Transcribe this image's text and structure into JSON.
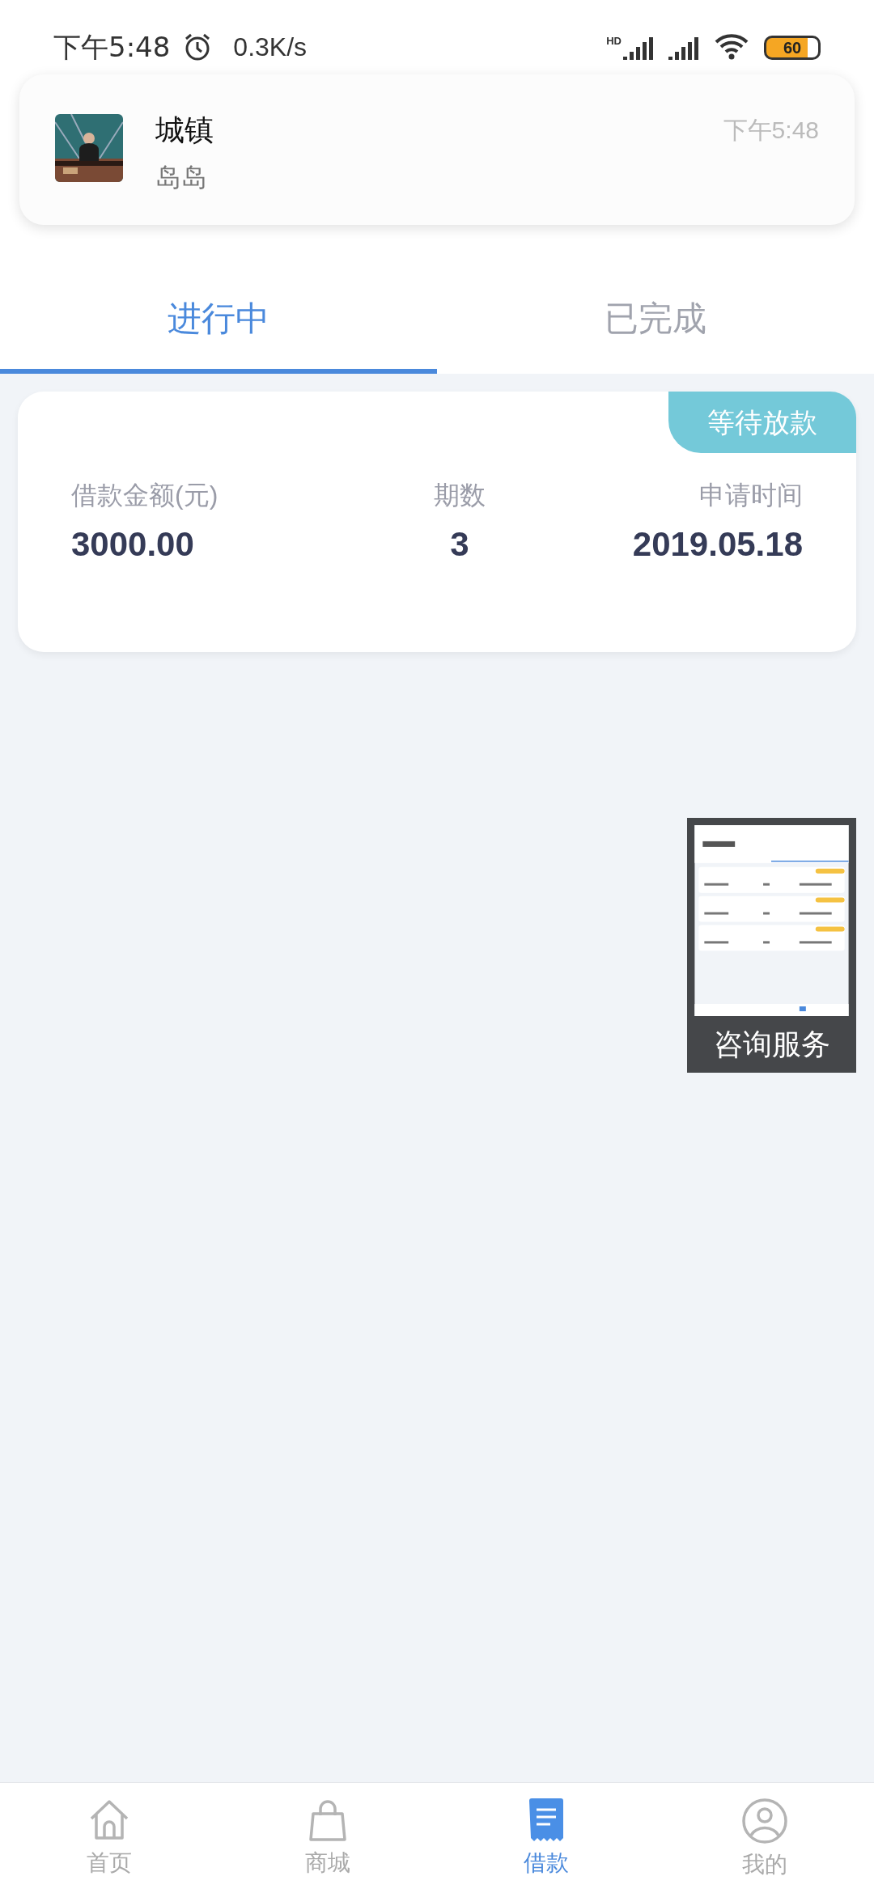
{
  "status_bar": {
    "time": "下午5:48",
    "speed": "0.3K/s",
    "network_label": "HD",
    "battery": "60"
  },
  "notification": {
    "title": "城镇",
    "body": "岛岛",
    "time": "下午5:48"
  },
  "tabs": [
    {
      "label": "进行中",
      "selected": true
    },
    {
      "label": "已完成",
      "selected": false
    }
  ],
  "loans": [
    {
      "status": "等待放款",
      "fields": [
        {
          "label": "借款金额(元)",
          "value": "3000.00"
        },
        {
          "label": "期数",
          "value": "3"
        },
        {
          "label": "申请时间",
          "value": "2019.05.18"
        }
      ]
    }
  ],
  "floating_button": {
    "label": "咨询服务"
  },
  "bottom_nav": [
    {
      "label": "首页",
      "kind": "home",
      "selected": false
    },
    {
      "label": "商城",
      "kind": "bag",
      "selected": false
    },
    {
      "label": "借款",
      "kind": "bill",
      "selected": true
    },
    {
      "label": "我的",
      "kind": "user",
      "selected": false
    }
  ]
}
